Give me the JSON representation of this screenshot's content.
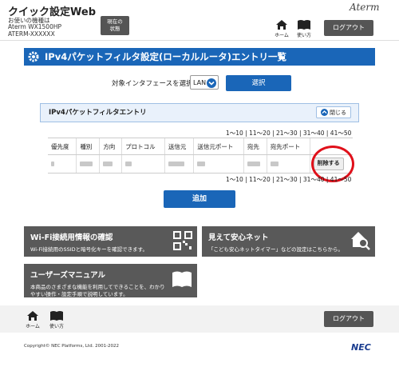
{
  "header": {
    "app_title": "クイック設定Web",
    "device_label": "お使いの機種は",
    "device_model": "Aterm WX1500HP",
    "device_id": "ATERM-XXXXXX",
    "status_button": [
      "現在の",
      "状態"
    ],
    "brand": "Aterm",
    "home_label": "ホーム",
    "manual_label": "使い方",
    "logout_label": "ログアウト"
  },
  "page": {
    "title": "IPv4パケットフィルタ設定(ローカルルータ)エントリ一覧",
    "interface_label": "対象インタフェースを選択",
    "interface_value": "LAN",
    "select_button": "選択"
  },
  "panel": {
    "title": "IPv4パケットフィルタエントリ",
    "close_label": "閉じる",
    "pager": [
      "1～10",
      "11～20",
      "21～30",
      "31～40",
      "41～50"
    ],
    "columns": [
      "優先度",
      "種別",
      "方向",
      "プロトコル",
      "送信元",
      "送信元ポート",
      "宛先",
      "宛先ポート",
      ""
    ],
    "delete_label": "削除する",
    "add_label": "追加"
  },
  "cards": {
    "wifi": {
      "title": "Wi-Fi接続用情報の確認",
      "desc": "Wi-Fi接続用のSSIDと暗号化キーを確認できます。"
    },
    "safety": {
      "title": "見えて安心ネット",
      "desc": "「こども安心ネットタイマー」などの設定はこちらから。"
    },
    "manual": {
      "title": "ユーザーズマニュアル",
      "desc": "本商品のさまざまな機能を利用してできることを、わかりやすい操作・設定手順で説明しています。"
    }
  },
  "footer": {
    "home_label": "ホーム",
    "manual_label": "使い方",
    "logout_label": "ログアウト",
    "copyright": "Copyright© NEC Platforms, Ltd. 2001-2022",
    "nec": "NEC"
  },
  "colors": {
    "accent": "#1a66b8",
    "card": "#595959",
    "highlight": "#e0101a"
  }
}
